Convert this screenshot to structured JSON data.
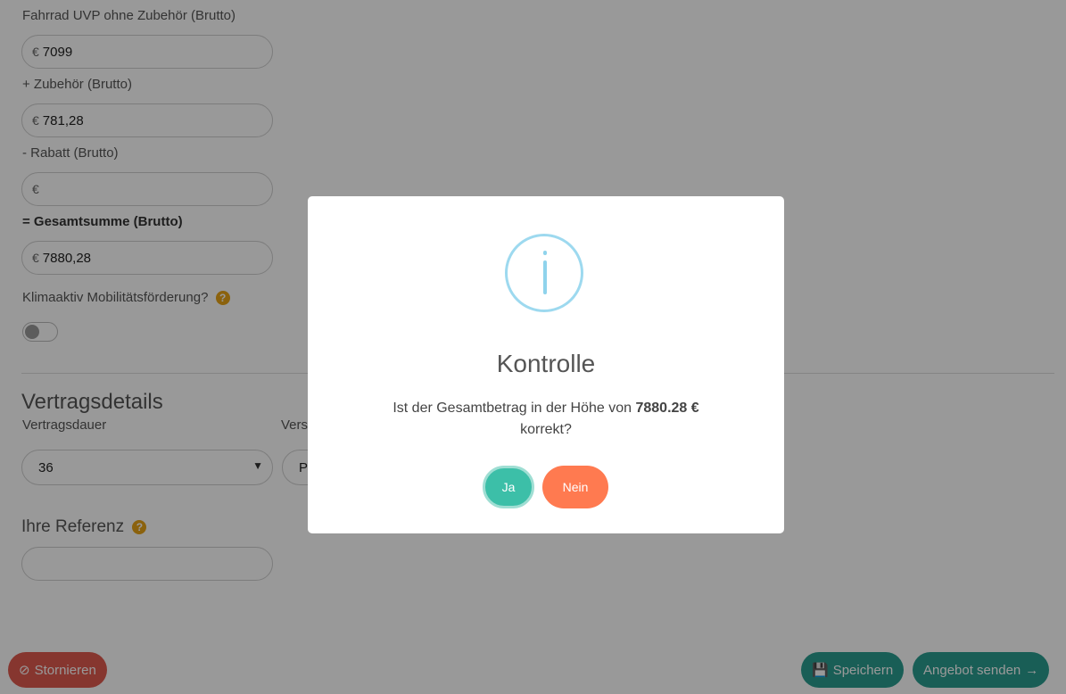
{
  "form": {
    "uvp_label": "Fahrrad UVP ohne Zubehör (Brutto)",
    "uvp_value": "7099",
    "zubehoer_label": "+ Zubehör (Brutto)",
    "zubehoer_value": "781,28",
    "rabatt_label": "- Rabatt (Brutto)",
    "rabatt_value": "",
    "summe_label": "= Gesamtsumme (Brutto)",
    "summe_value": "7880,28",
    "currency": "€",
    "klima_label": "Klimaaktiv Mobilitätsförderung?",
    "question_icon": "question-circle-icon"
  },
  "contract": {
    "heading": "Vertragsdetails",
    "dauer_label": "Vertragsdauer",
    "dauer_value": "36",
    "second_label_partial": "Vers",
    "second_value_partial": "P",
    "referenz_heading": "Ihre Referenz",
    "referenz_value": ""
  },
  "footer": {
    "cancel_label": "Stornieren",
    "save_label": "Speichern",
    "send_label": "Angebot senden"
  },
  "modal": {
    "title": "Kontrolle",
    "text_before": "Ist der Gesamtbetrag in der Höhe von",
    "amount": "7880.28 €",
    "text_after": "korrekt?",
    "yes_label": "Ja",
    "no_label": "Nein"
  },
  "colors": {
    "accent_green": "#2a9d8f",
    "cancel_red": "#e05a4f",
    "no_orange": "#ff7a50",
    "yes_teal": "#3cbfa8",
    "info_blue": "#9dd9ef"
  }
}
